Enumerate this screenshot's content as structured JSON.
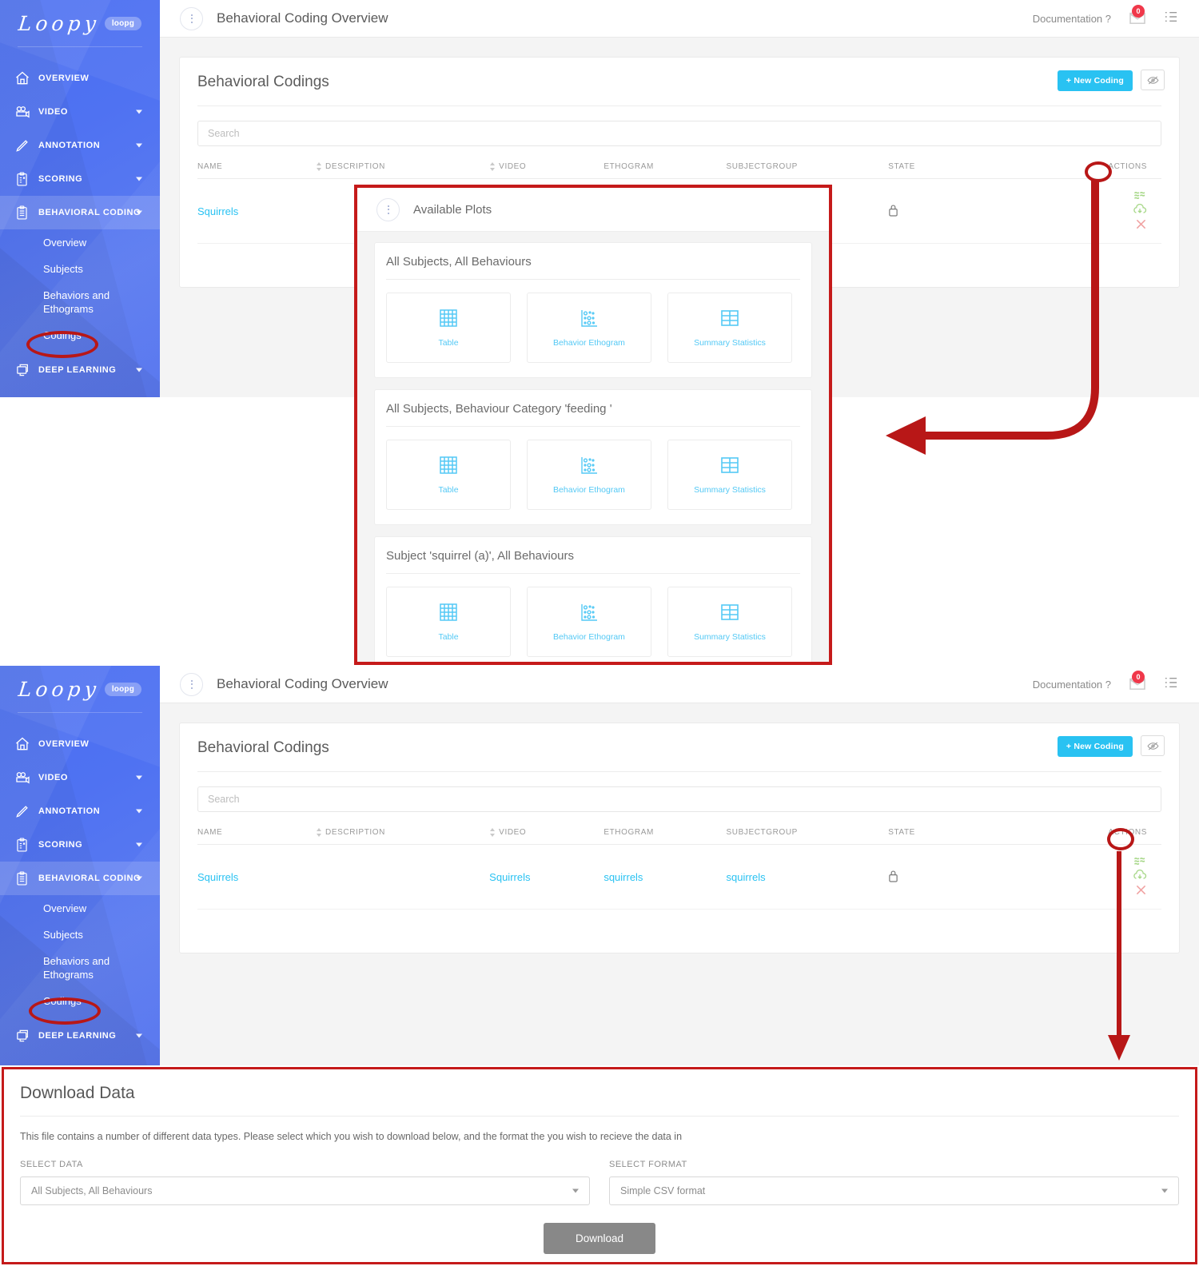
{
  "brand": {
    "logo_text": "Loopy",
    "logo_badge": "loopg",
    "accent": "#29c2f2",
    "sidebar_color": "#4f72f2",
    "annotation_color": "#b81717"
  },
  "topbar": {
    "title": "Behavioral Coding Overview",
    "documentation_label": "Documentation ?",
    "mail_badge": "0",
    "kebab_icon": "vertical-dots-icon",
    "mail_icon": "mail-icon",
    "list_icon": "list-icon"
  },
  "sidebar": {
    "items": [
      {
        "label": "OVERVIEW",
        "icon": "home-icon",
        "caret": false,
        "active": false
      },
      {
        "label": "VIDEO",
        "icon": "video-camera-icon",
        "caret": true,
        "active": false
      },
      {
        "label": "ANNOTATION",
        "icon": "pencil-icon",
        "caret": true,
        "active": false
      },
      {
        "label": "SCORING",
        "icon": "clipboard-check-icon",
        "caret": true,
        "active": false
      },
      {
        "label": "BEHAVIORAL CODING",
        "icon": "clipboard-list-icon",
        "caret": true,
        "active": true
      }
    ],
    "subitems": [
      "Overview",
      "Subjects",
      "Behaviors and Ethograms",
      "Codings"
    ],
    "highlighted_subitem": "Codings",
    "footer_item": {
      "label": "DEEP LEARNING",
      "icon": "deep-learning-icon",
      "caret": true
    }
  },
  "codings_card": {
    "title": "Behavioral Codings",
    "new_button": "+ New Coding",
    "eye_button_icon": "eye-slash-icon",
    "search_placeholder": "Search",
    "columns": [
      "NAME",
      "DESCRIPTION",
      "VIDEO",
      "ETHOGRAM",
      "SUBJECTGROUP",
      "STATE",
      "ACTIONS"
    ],
    "rows": [
      {
        "name": "Squirrels",
        "description": "",
        "video": "Squirrels",
        "ethogram": "squirrels",
        "subjectgroup": "squirrels",
        "state_icon": "lock-icon",
        "actions": [
          "plots-icon",
          "download-cloud-icon",
          "delete-x-icon"
        ]
      }
    ]
  },
  "plots_panel": {
    "title": "Available Plots",
    "kebab_icon": "vertical-dots-icon",
    "groups": [
      {
        "title": "All Subjects, All Behaviours",
        "tiles": [
          {
            "label": "Table",
            "icon": "table-grid-icon"
          },
          {
            "label": "Behavior Ethogram",
            "icon": "scatter-plot-icon"
          },
          {
            "label": "Summary Statistics",
            "icon": "summary-table-icon"
          }
        ]
      },
      {
        "title": "All Subjects, Behaviour Category 'feeding '",
        "tiles": [
          {
            "label": "Table",
            "icon": "table-grid-icon"
          },
          {
            "label": "Behavior Ethogram",
            "icon": "scatter-plot-icon"
          },
          {
            "label": "Summary Statistics",
            "icon": "summary-table-icon"
          }
        ]
      },
      {
        "title": "Subject 'squirrel (a)', All Behaviours",
        "tiles": [
          {
            "label": "Table",
            "icon": "table-grid-icon"
          },
          {
            "label": "Behavior Ethogram",
            "icon": "scatter-plot-icon"
          },
          {
            "label": "Summary Statistics",
            "icon": "summary-table-icon"
          }
        ]
      }
    ]
  },
  "download_panel": {
    "title": "Download Data",
    "description": "This file contains a number of different data types. Please select which you wish to download below, and the format the you wish to recieve the data in",
    "select_data_label": "SELECT DATA",
    "select_data_value": "All Subjects, All Behaviours",
    "select_format_label": "SELECT FORMAT",
    "select_format_value": "Simple CSV format",
    "download_button": "Download"
  }
}
